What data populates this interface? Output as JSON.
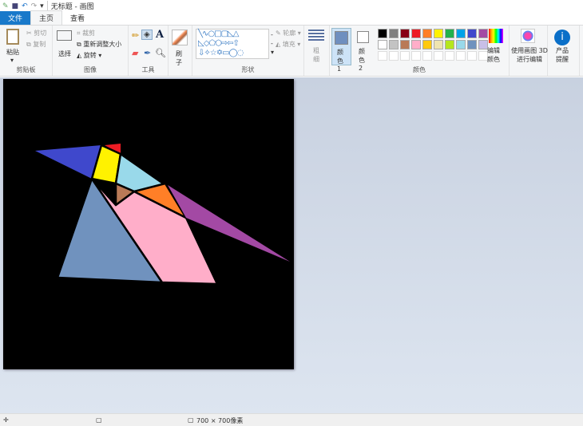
{
  "title": "无标题 - 画图",
  "tabs": [
    {
      "label": "文件"
    },
    {
      "label": "主页"
    },
    {
      "label": "查看"
    }
  ],
  "clipboard": {
    "paste": "粘贴",
    "cut": "剪切",
    "copy": "复制",
    "label": "剪贴板"
  },
  "image": {
    "select": "选择",
    "crop": "裁剪",
    "resize": "重新调整大小",
    "rotate": "旋转",
    "label": "图像"
  },
  "tools": {
    "label": "工具"
  },
  "brush": {
    "label": "刷子"
  },
  "shapes": {
    "outline": "轮廓",
    "fill": "填充",
    "label": "形状"
  },
  "size": {
    "label": "粗细"
  },
  "colors": {
    "color1": "颜色 1",
    "color2": "颜色 2",
    "edit": "编辑颜色",
    "label": "颜色",
    "color1_value": "#6f8fbf",
    "color2_value": "#ffffff",
    "palette_row1": [
      "#000000",
      "#7f7f7f",
      "#880015",
      "#ed1c24",
      "#ff7f27",
      "#fff200",
      "#22b14c",
      "#00a2e8",
      "#3f48cc",
      "#a349a4"
    ],
    "palette_row2": [
      "#ffffff",
      "#c3c3c3",
      "#b97a57",
      "#ffaec9",
      "#ffc90e",
      "#efe4b0",
      "#b5e61d",
      "#99d9ea",
      "#7092be",
      "#c8bfe7"
    ]
  },
  "paint3d": {
    "label": "使用画图 3D 进行编辑"
  },
  "product": {
    "label": "产品提醒"
  },
  "status": {
    "size": "700 × 700像素"
  }
}
